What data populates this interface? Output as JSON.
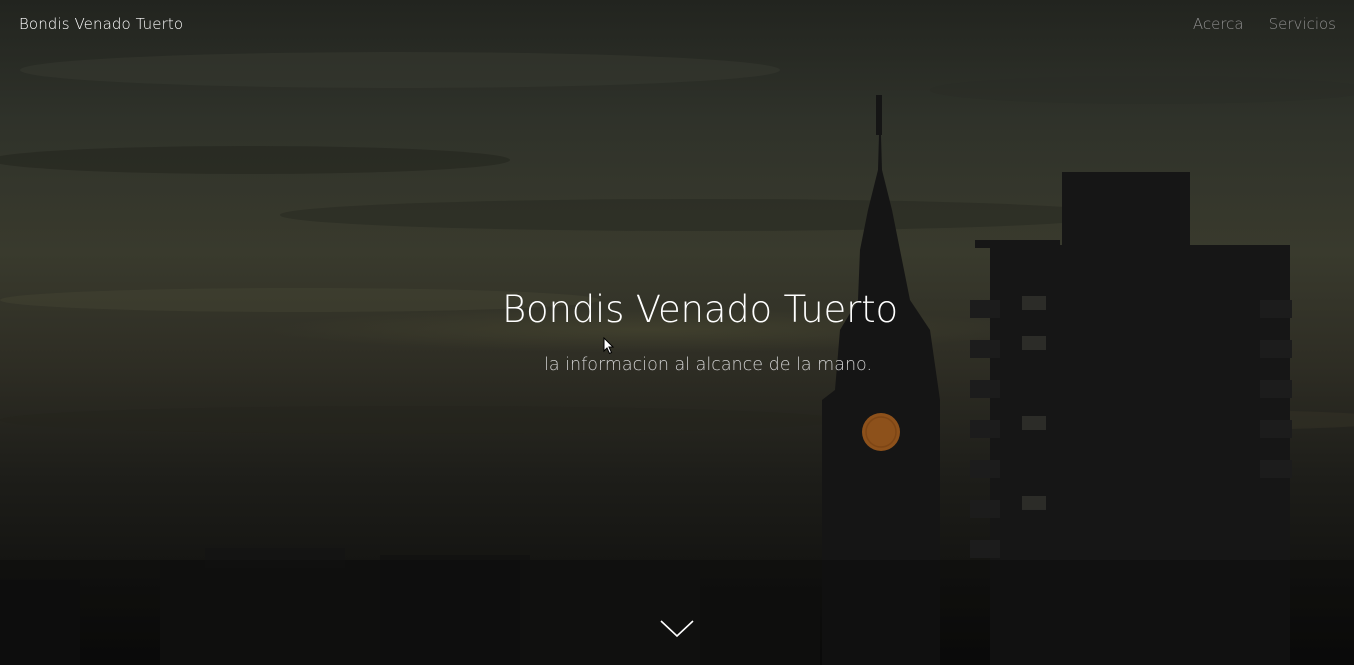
{
  "navbar": {
    "brand": "Bondis Venado Tuerto",
    "links": [
      {
        "label": "Acerca"
      },
      {
        "label": "Servicios"
      }
    ]
  },
  "hero": {
    "title": "Bondis Venado Tuerto",
    "subtitle": "la informacion al alcance de la mano.",
    "scroll_icon": "chevron-down-icon"
  },
  "colors": {
    "brand_text": "#ffffff",
    "nav_link": "#8e8e8e",
    "subtitle": "#cfcfcf",
    "clock_face": "#b5651d"
  }
}
